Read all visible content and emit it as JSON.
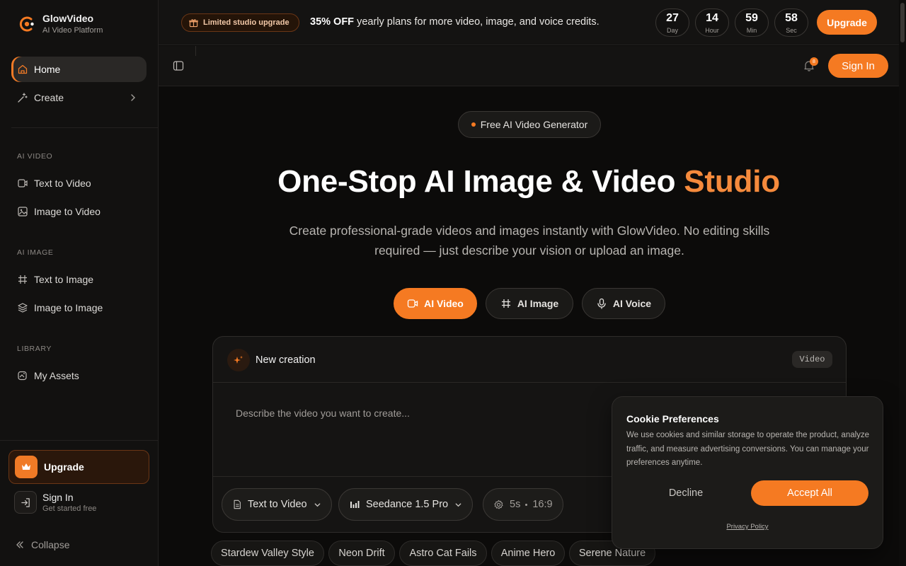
{
  "brand": {
    "name": "GlowVideo",
    "subtitle": "AI Video Platform",
    "accent": "#f57a22"
  },
  "sidebar": {
    "primary": [
      {
        "label": "Home",
        "icon": "home-icon",
        "active": true
      },
      {
        "label": "Create",
        "icon": "sparkle-wand-icon"
      }
    ],
    "sections": [
      {
        "title": "AI VIDEO",
        "items": [
          {
            "label": "Text to Video",
            "icon": "video-camera-icon"
          },
          {
            "label": "Image to Video",
            "icon": "image-icon"
          }
        ]
      },
      {
        "title": "AI IMAGE",
        "items": [
          {
            "label": "Text to Image",
            "icon": "hash-icon"
          },
          {
            "label": "Image to Image",
            "icon": "layers-icon"
          }
        ]
      },
      {
        "title": "LIBRARY",
        "items": [
          {
            "label": "My Assets",
            "icon": "assets-icon"
          }
        ]
      }
    ],
    "upgrade_label": "Upgrade",
    "signin_title": "Sign In",
    "signin_subtitle": "Get started free",
    "collapse_label": "Collapse"
  },
  "promo": {
    "tag": "Limited studio upgrade",
    "highlight": "35% OFF",
    "text": " yearly plans for more video, image, and voice credits.",
    "countdown": [
      {
        "value": "27",
        "unit": "Day"
      },
      {
        "value": "14",
        "unit": "Hour"
      },
      {
        "value": "59",
        "unit": "Min"
      },
      {
        "value": "58",
        "unit": "Sec"
      }
    ],
    "button": "Upgrade"
  },
  "header": {
    "notification_count": "8",
    "signin_label": "Sign In"
  },
  "hero": {
    "pill": "Free AI Video Generator",
    "title_main": "One-Stop AI Image & Video ",
    "title_accent": "Studio",
    "description": "Create professional-grade videos and images instantly with GlowVideo. No editing skills required — just describe your vision or upload an image."
  },
  "modes": [
    {
      "label": "AI Video",
      "icon": "video-camera-icon",
      "active": true
    },
    {
      "label": "AI Image",
      "icon": "hash-icon"
    },
    {
      "label": "AI Voice",
      "icon": "microphone-icon"
    }
  ],
  "composer": {
    "title": "New creation",
    "badge": "Video",
    "placeholder": "Describe the video you want to create...",
    "mode_chip": "Text to Video",
    "model_chip": "Seedance 1.5 Pro",
    "duration": "5s",
    "ratio": "16:9"
  },
  "suggestions": [
    "Stardew Valley Style",
    "Neon Drift",
    "Astro Cat Fails",
    "Anime Hero",
    "Serene Nature"
  ],
  "cookie": {
    "title": "Cookie Preferences",
    "body": "We use cookies and similar storage to operate the product, analyze traffic, and measure advertising conversions. You can manage your preferences anytime.",
    "decline": "Decline",
    "accept": "Accept All",
    "privacy": "Privacy Policy"
  }
}
